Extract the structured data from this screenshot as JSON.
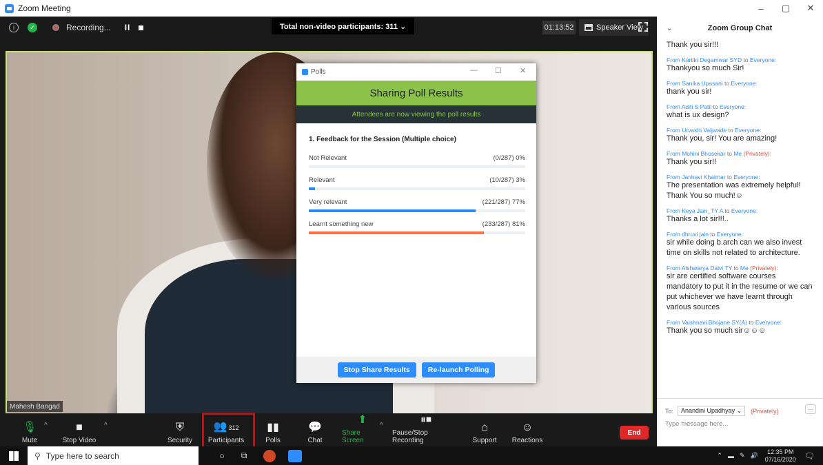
{
  "window": {
    "title": "Zoom Meeting"
  },
  "topbar": {
    "recording_label": "Recording...",
    "pause_glyph": "II",
    "non_video_banner": "Total non-video participants: 311 ⌄",
    "timer": "01:13:52",
    "speaker_view": "Speaker View"
  },
  "video": {
    "name_tag": "Mahesh Bangad"
  },
  "poll": {
    "window_title": "Polls",
    "header": "Sharing Poll Results",
    "subheader": "Attendees are now viewing the poll results",
    "question": "1. Feedback for the Session (Multiple choice)",
    "options": [
      {
        "label": "Not Relevant",
        "result": "(0/287) 0%",
        "percent": 0,
        "color": "#2d8cff"
      },
      {
        "label": "Relevant",
        "result": "(10/287) 3%",
        "percent": 3,
        "color": "#2d8cff"
      },
      {
        "label": "Very relevant",
        "result": "(221/287) 77%",
        "percent": 77,
        "color": "#2d8cff"
      },
      {
        "label": "Learnt something new",
        "result": "(233/287) 81%",
        "percent": 81,
        "color": "#ff7043"
      }
    ],
    "stop_share": "Stop Share Results",
    "relaunch": "Re-launch Polling"
  },
  "toolbar": {
    "mute": "Mute",
    "stop_video": "Stop Video",
    "security": "Security",
    "participants": "Participants",
    "participants_count": "312",
    "polls": "Polls",
    "chat": "Chat",
    "share_screen": "Share Screen",
    "pause_stop_recording": "Pause/Stop Recording",
    "support": "Support",
    "reactions": "Reactions",
    "end": "End"
  },
  "chat": {
    "title": "Zoom Group Chat",
    "messages": [
      {
        "from": "",
        "to": "",
        "private": "",
        "text": "Thank you sir!!!"
      },
      {
        "from": "From Kartiki Degamwar SYD",
        "to": "Everyone",
        "private": "",
        "text": "Thankyou so much Sir!"
      },
      {
        "from": "From Sanika Upasani",
        "to": "Everyone",
        "private": "",
        "text": "thank you sir!"
      },
      {
        "from": "From Aditi S Patil",
        "to": "Everyone",
        "private": "",
        "text": "what is ux design?"
      },
      {
        "from": "From Urvashi Vaijwade",
        "to": "Everyone",
        "private": "",
        "text": "Thank you, sir! You are amazing!"
      },
      {
        "from": "From Mohini Bhosekar",
        "to": "Me",
        "private": "(Privately)",
        "text": "Thank you sir!!"
      },
      {
        "from": "From Janhavi Khalmar",
        "to": "Everyone",
        "private": "",
        "text": "The presentation was extremely helpful! Thank You so much!☺"
      },
      {
        "from": "From Keya Jain_TY A",
        "to": "Everyone",
        "private": "",
        "text": "Thanks a lot sir!!!.."
      },
      {
        "from": "From dhruvi jain",
        "to": "Everyone",
        "private": "",
        "text": "sir while doing b.arch can we also invest time on skills not related to architecture."
      },
      {
        "from": "From Aishwarya Dalvi TY",
        "to": "Me",
        "private": "(Privately)",
        "text": "sir are certified software courses mandatory to put it in the resume or we can put whichever we have learnt through various sources"
      },
      {
        "from": "From Vaishnavi Bhojane SY(A)",
        "to": "Everyone",
        "private": "",
        "text": "Thank you so much sir☺☺☺"
      }
    ],
    "to_label": "To:",
    "to_value": "Anandini Upadhyay ⌄",
    "to_private": "(Privately)",
    "more": "···",
    "input_placeholder": "Type message here..."
  },
  "taskbar": {
    "search_placeholder": "Type here to search",
    "time": "12:35 PM",
    "date": "07/16/2020"
  }
}
